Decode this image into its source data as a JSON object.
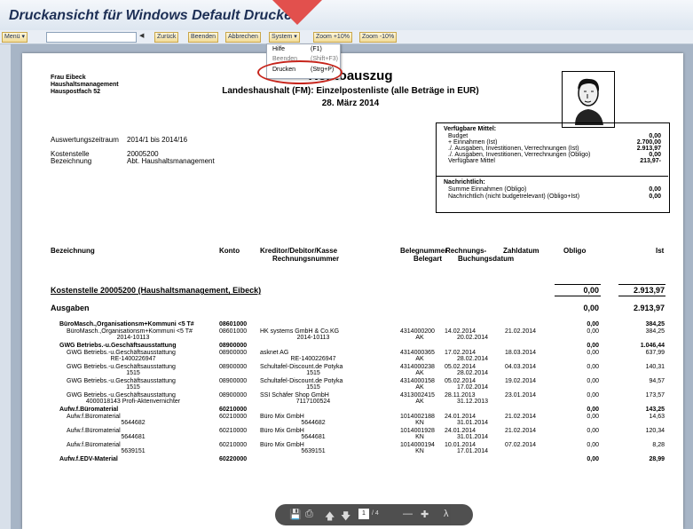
{
  "window": {
    "title": "Druckansicht für Windows Default Drucker"
  },
  "toolbar": {
    "menu_label": "Menü ▾",
    "prev_glyph": "◀",
    "buttons": [
      "Zurück",
      "Beenden",
      "Abbrechen",
      "System ▾",
      "Zoom +10%",
      "Zoom -10%"
    ]
  },
  "system_menu": {
    "items": [
      {
        "label": "Hilfe",
        "key": "(F1)"
      },
      {
        "label": "Beenden",
        "key": "(Shift+F3)"
      },
      {
        "label": "Drucken",
        "key": "(Strg+P)"
      }
    ]
  },
  "report": {
    "address": [
      "Frau Eibeck",
      "Haushaltsmanagement",
      "Hauspostfach 52"
    ],
    "title": "Kontoauszug",
    "subtitle": "Landeshaushalt (FM): Einzelpostenliste (alle Beträge in EUR)",
    "date": "28. März 2014",
    "meta": [
      {
        "label": "Auswertungszeitraum",
        "value": "2014/1 bis 2014/16"
      },
      {
        "label": "Kostenstelle",
        "value": "20005200"
      },
      {
        "label": "Bezeichnung",
        "value": "Abt. Haushaltsmanagement"
      }
    ],
    "funds": {
      "heading": "Verfügbare Mittel:",
      "lines": [
        {
          "label": "Budget",
          "value": "0,00"
        },
        {
          "label": "+ Einnahmen (Ist)",
          "value": "2.700,00"
        },
        {
          "label": "./. Ausgaben, Investitionen, Verrechnungen (Ist)",
          "value": "2.913,97"
        },
        {
          "label": "./. Ausgaben, Investitionen, Verrechnungen (Obligo)",
          "value": "0,00"
        },
        {
          "label": "Verfügbare Mittel",
          "value": "213,97-"
        }
      ],
      "heading2": "Nachrichtlich:",
      "lines2": [
        {
          "label": "Summe Einnahmen (Obligo)",
          "value": "0,00"
        },
        {
          "label": "Nachrichtlich (nicht budgetrelevant) (Obligo+Ist)",
          "value": "0,00"
        }
      ]
    },
    "columns": {
      "bezeichnung": "Bezeichnung",
      "konto": "Konto",
      "kreditor": "Kreditor/Debitor/Kasse",
      "rechnungsnummer": "Rechnungsnummer",
      "belegnummer": "Belegnummer",
      "belegart": "Belegart",
      "rechnungs": "Rechnungs-",
      "buchungsdatum": "Buchungsdatum",
      "zahldatum": "Zahldatum",
      "obligo": "Obligo",
      "ist": "Ist"
    },
    "kostenstelle": {
      "label": "Kostenstelle 20005200 (Haushaltsmanagement, Eibeck)",
      "obligo": "0,00",
      "ist": "2.913,97"
    },
    "ausgaben": {
      "label": "Ausgaben",
      "obligo": "0,00",
      "ist": "2.913,97"
    },
    "rows": [
      {
        "bold": true,
        "bez": "BüroMasch.,Organisationsm+Kommuni <5 T#",
        "bez2": "",
        "konto": "08601000",
        "kred": "",
        "kred2": "",
        "beleg": "",
        "belegart": "",
        "rdat": "",
        "bdat": "",
        "zdat": "",
        "obligo": "0,00",
        "ist": "384,25"
      },
      {
        "bold": false,
        "bez": "BüroMasch.,Organisationsm+Kommuni <5 T#",
        "bez2": "2014-10113",
        "konto": "08601000",
        "kred": "HK systems GmbH & Co.KG",
        "kred2": "2014-10113",
        "beleg": "4314000200",
        "belegart": "AK",
        "rdat": "14.02.2014",
        "bdat": "20.02.2014",
        "zdat": "21.02.2014",
        "obligo": "0,00",
        "ist": "384,25"
      },
      {
        "bold": true,
        "bez": "GWG Betriebs.-u.Geschäftsausstattung",
        "bez2": "",
        "konto": "08900000",
        "kred": "",
        "kred2": "",
        "beleg": "",
        "belegart": "",
        "rdat": "",
        "bdat": "",
        "zdat": "",
        "obligo": "0,00",
        "ist": "1.046,44"
      },
      {
        "bold": false,
        "bez": "GWG Betriebs.-u.Geschäftsausstattung",
        "bez2": "RE-1400226947",
        "konto": "08900000",
        "kred": "asknet AG",
        "kred2": "RE-1400226947",
        "beleg": "4314000365",
        "belegart": "AK",
        "rdat": "17.02.2014",
        "bdat": "28.02.2014",
        "zdat": "18.03.2014",
        "obligo": "0,00",
        "ist": "637,99"
      },
      {
        "bold": false,
        "bez": "GWG Betriebs.-u.Geschäftsausstattung",
        "bez2": "1515",
        "konto": "08900000",
        "kred": "Schultafel-Discount.de Potyka",
        "kred2": "1515",
        "beleg": "4314000238",
        "belegart": "AK",
        "rdat": "05.02.2014",
        "bdat": "28.02.2014",
        "zdat": "04.03.2014",
        "obligo": "0,00",
        "ist": "140,31"
      },
      {
        "bold": false,
        "bez": "GWG Betriebs.-u.Geschäftsausstattung",
        "bez2": "1515",
        "konto": "08900000",
        "kred": "Schultafel-Discount.de Potyka",
        "kred2": "1515",
        "beleg": "4314000158",
        "belegart": "AK",
        "rdat": "05.02.2014",
        "bdat": "17.02.2014",
        "zdat": "19.02.2014",
        "obligo": "0,00",
        "ist": "94,57"
      },
      {
        "bold": false,
        "bez": "GWG Betriebs.-u.Geschäftsausstattung",
        "bez2": "4000018143 Profi-Aktenvernichter",
        "konto": "08900000",
        "kred": "SSI Schäfer Shop GmbH",
        "kred2": "7117100524",
        "beleg": "4313002415",
        "belegart": "AK",
        "rdat": "28.11.2013",
        "bdat": "31.12.2013",
        "zdat": "23.01.2014",
        "obligo": "0,00",
        "ist": "173,57"
      },
      {
        "bold": true,
        "bez": "Aufw.f.Büromaterial",
        "bez2": "",
        "konto": "60210000",
        "kred": "",
        "kred2": "",
        "beleg": "",
        "belegart": "",
        "rdat": "",
        "bdat": "",
        "zdat": "",
        "obligo": "0,00",
        "ist": "143,25"
      },
      {
        "bold": false,
        "bez": "Aufw.f.Büromaterial",
        "bez2": "5644682",
        "konto": "60210000",
        "kred": "Büro Mix GmbH",
        "kred2": "5644682",
        "beleg": "1014002188",
        "belegart": "KN",
        "rdat": "24.01.2014",
        "bdat": "31.01.2014",
        "zdat": "21.02.2014",
        "obligo": "0,00",
        "ist": "14,63"
      },
      {
        "bold": false,
        "bez": "Aufw.f.Büromaterial",
        "bez2": "5644681",
        "konto": "60210000",
        "kred": "Büro Mix GmbH",
        "kred2": "5644681",
        "beleg": "1014001928",
        "belegart": "KN",
        "rdat": "24.01.2014",
        "bdat": "31.01.2014",
        "zdat": "21.02.2014",
        "obligo": "0,00",
        "ist": "120,34"
      },
      {
        "bold": false,
        "bez": "Aufw.f.Büromaterial",
        "bez2": "5639151",
        "konto": "60210000",
        "kred": "Büro Mix GmbH",
        "kred2": "5639151",
        "beleg": "1014000194",
        "belegart": "KN",
        "rdat": "10.01.2014",
        "bdat": "17.01.2014",
        "zdat": "07.02.2014",
        "obligo": "0,00",
        "ist": "8,28"
      },
      {
        "bold": true,
        "bez": "Aufw.f.EDV-Material",
        "bez2": "",
        "konto": "60220000",
        "kred": "",
        "kred2": "",
        "beleg": "",
        "belegart": "",
        "rdat": "",
        "bdat": "",
        "zdat": "",
        "obligo": "0,00",
        "ist": "28,99"
      }
    ]
  },
  "pdf_toolbar": {
    "page": "1",
    "pages": "/ 4"
  }
}
